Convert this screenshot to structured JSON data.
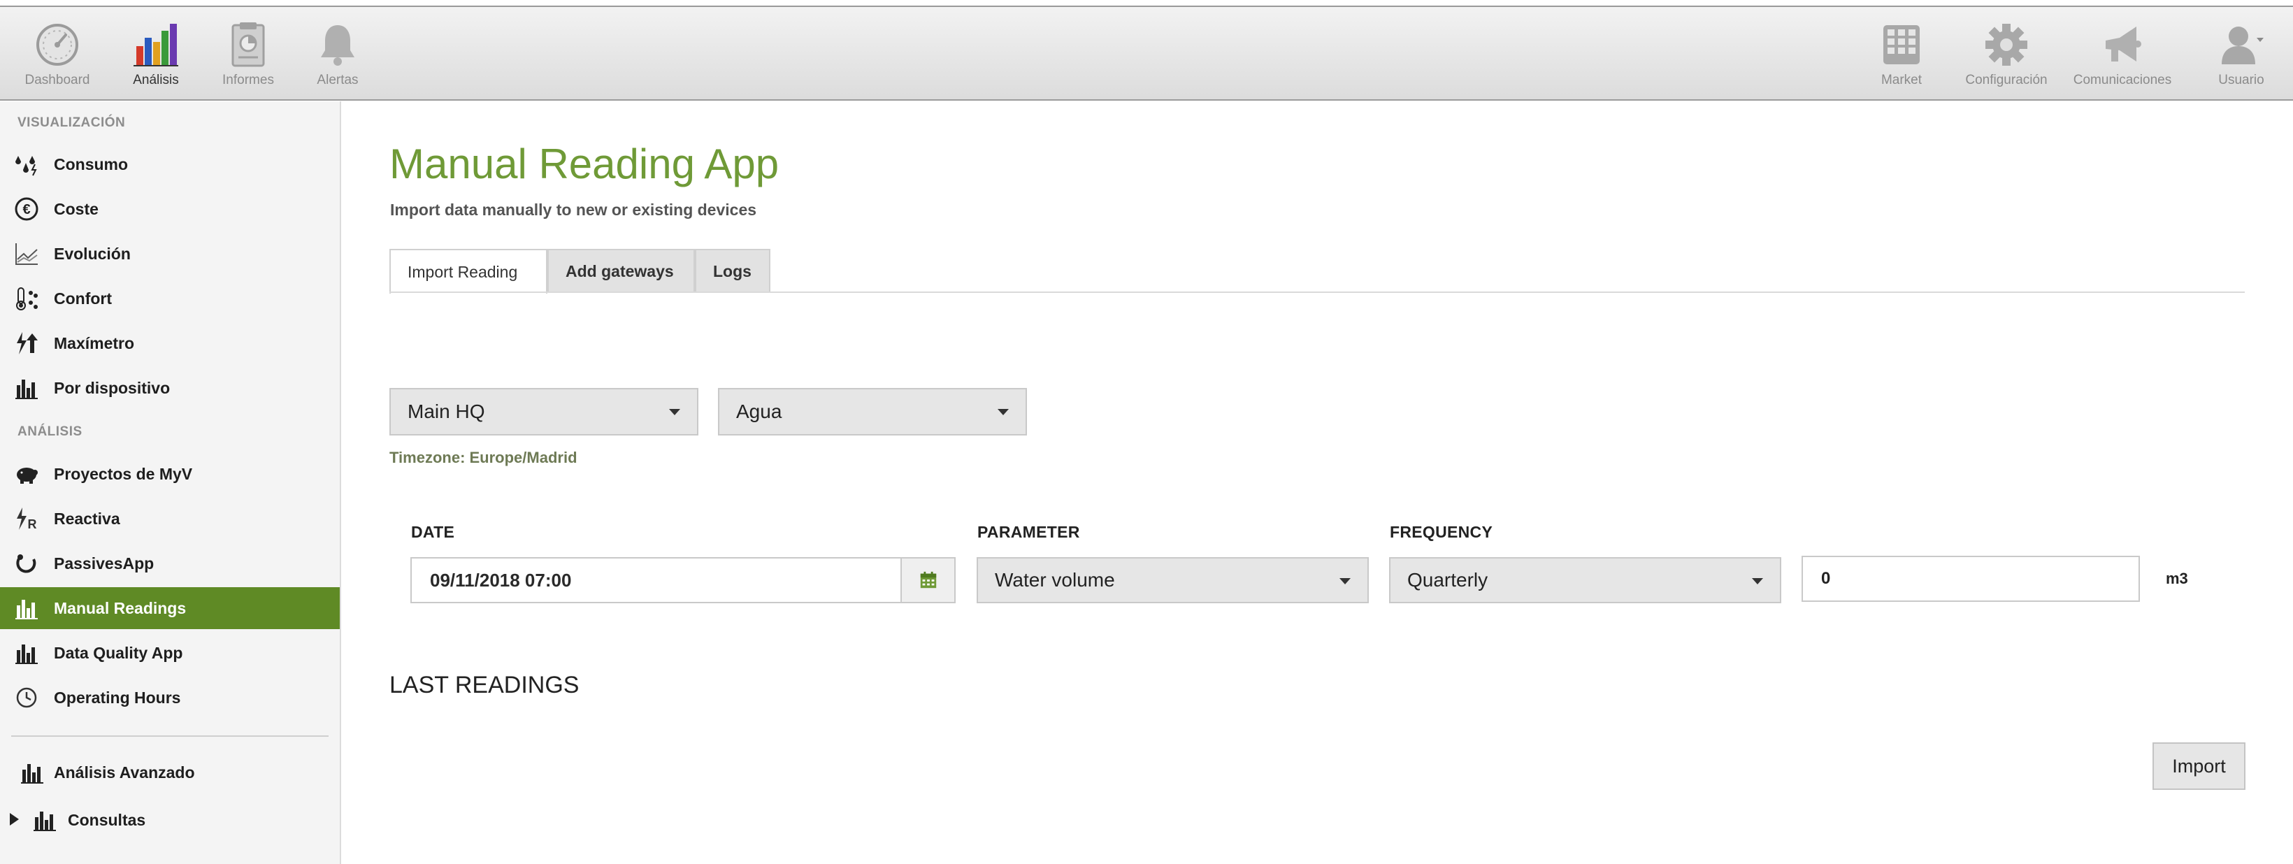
{
  "topnav": {
    "left": [
      {
        "label": "Dashboard",
        "icon": "speedometer-icon",
        "active": false
      },
      {
        "label": "Análisis",
        "icon": "bar-chart-icon",
        "active": true
      },
      {
        "label": "Informes",
        "icon": "report-icon",
        "active": false
      },
      {
        "label": "Alertas",
        "icon": "bell-icon",
        "active": false
      }
    ],
    "right": [
      {
        "label": "Market",
        "icon": "grid-icon"
      },
      {
        "label": "Configuración",
        "icon": "gear-icon"
      },
      {
        "label": "Comunicaciones",
        "icon": "megaphone-icon"
      },
      {
        "label": "Usuario",
        "icon": "user-icon"
      }
    ]
  },
  "sidebar": {
    "visualizacion_header": "VISUALIZACIÓN",
    "analisis_header": "ANÁLISIS",
    "items": [
      {
        "label": "Consumo",
        "icon": "drops-icon"
      },
      {
        "label": "Coste",
        "icon": "euro-icon"
      },
      {
        "label": "Evolución",
        "icon": "line-chart-icon"
      },
      {
        "label": "Confort",
        "icon": "thermometer-icon"
      },
      {
        "label": "Maxímetro",
        "icon": "bolt-arrow-icon"
      },
      {
        "label": "Por dispositivo",
        "icon": "bars-icon"
      },
      {
        "label": "Proyectos de MyV",
        "icon": "piggy-bank-icon"
      },
      {
        "label": "Reactiva",
        "icon": "bolt-r-icon"
      },
      {
        "label": "PassivesApp",
        "icon": "passives-icon"
      },
      {
        "label": "Manual Readings",
        "icon": "bars-icon",
        "active": true
      },
      {
        "label": "Data Quality App",
        "icon": "bars-icon"
      },
      {
        "label": "Operating Hours",
        "icon": "clock-icon"
      },
      {
        "label": "Análisis Avanzado",
        "icon": "bars-icon"
      },
      {
        "label": "Consultas",
        "icon": "bars-icon"
      }
    ]
  },
  "main": {
    "title": "Manual Reading App",
    "subtitle": "Import data manually to new or existing devices",
    "tabs": [
      {
        "label": "Import Reading",
        "active": true
      },
      {
        "label": "Add gateways"
      },
      {
        "label": "Logs"
      }
    ],
    "location_select": "Main HQ",
    "type_select": "Agua",
    "timezone": "Timezone: Europe/Madrid",
    "form": {
      "date_label": "DATE",
      "date_value": "09/11/2018 07:00",
      "parameter_label": "PARAMETER",
      "parameter_value": "Water volume",
      "frequency_label": "FREQUENCY",
      "frequency_value": "Quarterly",
      "value": "0",
      "unit": "m3"
    },
    "last_readings_title": "LAST READINGS",
    "import_label": "Import"
  },
  "colors": {
    "accent_green": "#6f9a37",
    "active_sidebar": "#5f8a25"
  }
}
